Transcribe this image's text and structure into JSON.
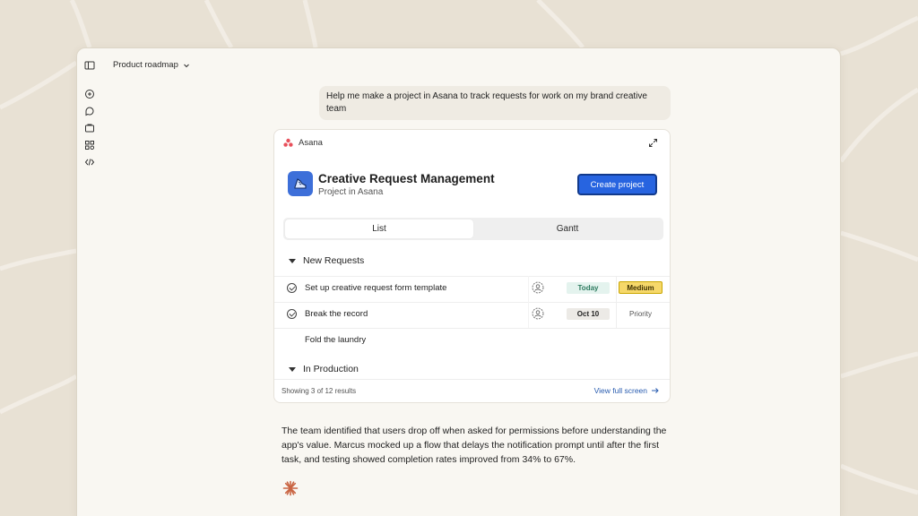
{
  "colors": {
    "background": "#e8e1d4",
    "window": "#f9f7f2",
    "accent_button": "#2764e0",
    "today_badge": "#e4f3ee",
    "date_badge": "#eceae6",
    "medium_badge": "#f6d86a",
    "asana_logo": "#e8505b",
    "spark": "#c96442",
    "link": "#2a5db0"
  },
  "sidebar": {
    "icons": [
      "sidebar-toggle-icon",
      "new-chat-icon",
      "chat-bubble-icon",
      "projects-icon",
      "artifacts-icon",
      "code-icon"
    ]
  },
  "header": {
    "title": "Product roadmap",
    "dropdown_icon": "chevron-down-icon"
  },
  "user_message": "Help me make a project in Asana to track requests for work on my brand creative team",
  "card": {
    "app_name": "Asana",
    "project_title": "Creative Request Management",
    "project_subtitle": "Project in Asana",
    "create_button": "Create project",
    "tabs": [
      {
        "label": "List",
        "active": true
      },
      {
        "label": "Gantt",
        "active": false
      }
    ],
    "sections": [
      {
        "title": "New Requests",
        "tasks": [
          {
            "name": "Set up creative request form template",
            "date": "Today",
            "priority": "Medium",
            "completed_icon": true
          },
          {
            "name": "Break the record",
            "date": "Oct 10",
            "priority": "Priority",
            "completed_icon": true
          },
          {
            "name": "Fold the laundry",
            "date": "",
            "priority": "",
            "completed_icon": false
          }
        ]
      },
      {
        "title": "In Production",
        "tasks": []
      }
    ],
    "footer": {
      "showing": "Showing 3 of 12 results",
      "view_full": "View full screen"
    }
  },
  "response": "The team identified that users drop off when asked for permissions before understanding the app's value. Marcus mocked up a flow that delays the notification prompt until after the first task, and testing showed completion rates improved from 34% to 67%."
}
